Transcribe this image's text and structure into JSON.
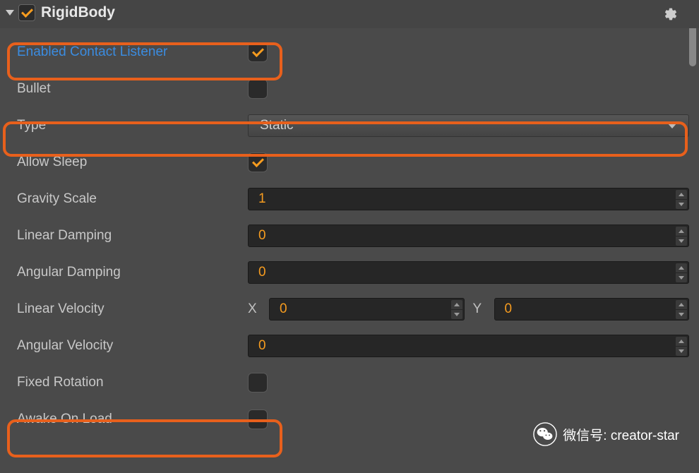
{
  "header": {
    "title": "RigidBody",
    "enabled": true
  },
  "properties": {
    "enabledContactListener": {
      "label": "Enabled Contact Listener",
      "checked": true
    },
    "bullet": {
      "label": "Bullet",
      "checked": false
    },
    "type": {
      "label": "Type",
      "value": "Static"
    },
    "allowSleep": {
      "label": "Allow Sleep",
      "checked": true
    },
    "gravityScale": {
      "label": "Gravity Scale",
      "value": "1"
    },
    "linearDamping": {
      "label": "Linear Damping",
      "value": "0"
    },
    "angularDamping": {
      "label": "Angular Damping",
      "value": "0"
    },
    "linearVelocity": {
      "label": "Linear Velocity",
      "xLabel": "X",
      "x": "0",
      "yLabel": "Y",
      "y": "0"
    },
    "angularVelocity": {
      "label": "Angular Velocity",
      "value": "0"
    },
    "fixedRotation": {
      "label": "Fixed Rotation",
      "checked": false
    },
    "awakeOnLoad": {
      "label": "Awake On Load",
      "checked": false
    }
  },
  "watermark": {
    "label": "微信号: creator-star"
  }
}
